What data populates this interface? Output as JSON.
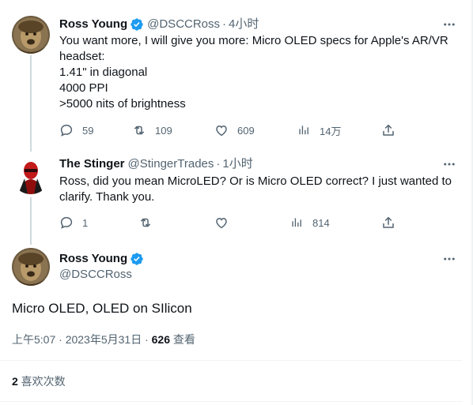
{
  "tweets": [
    {
      "name": "Ross Young",
      "handle": "@DSCCRoss",
      "separator": "·",
      "time": "4小时",
      "lines": [
        "You want more, I will give you more: Micro OLED specs for Apple's AR/VR",
        "headset:",
        "1.41\" in diagonal",
        "4000 PPI",
        ">5000 nits of brightness"
      ],
      "replies": "59",
      "retweets": "109",
      "likes": "609",
      "views": "14万",
      "verified": true
    },
    {
      "name": "The Stinger",
      "handle": "@StingerTrades",
      "separator": "·",
      "time": "1小时",
      "lines": [
        "Ross, did you mean MicroLED? Or is Micro OLED correct? I just wanted to",
        "clarify. Thank you."
      ],
      "replies": "1",
      "retweets": "",
      "likes": "",
      "views": "814",
      "verified": false
    }
  ],
  "main_tweet": {
    "name": "Ross Young",
    "handle": "@DSCCRoss",
    "text": "Micro OLED, OLED on SIlicon",
    "timestamp": "上午5:07 · 2023年5月31日 · ",
    "view_count": "626",
    "view_label": " 查看",
    "likes_count": "2",
    "likes_label": " 喜欢次数",
    "verified": true
  },
  "colors": {
    "verified": "#1d9bf0",
    "secondary_text": "#536471",
    "thread_line": "#cfd9de",
    "divider": "#eff3f4"
  },
  "icons": {
    "reply": "reply-icon",
    "retweet": "retweet-icon",
    "like": "heart-icon",
    "views": "views-icon",
    "share": "share-icon",
    "more": "more-icon"
  }
}
